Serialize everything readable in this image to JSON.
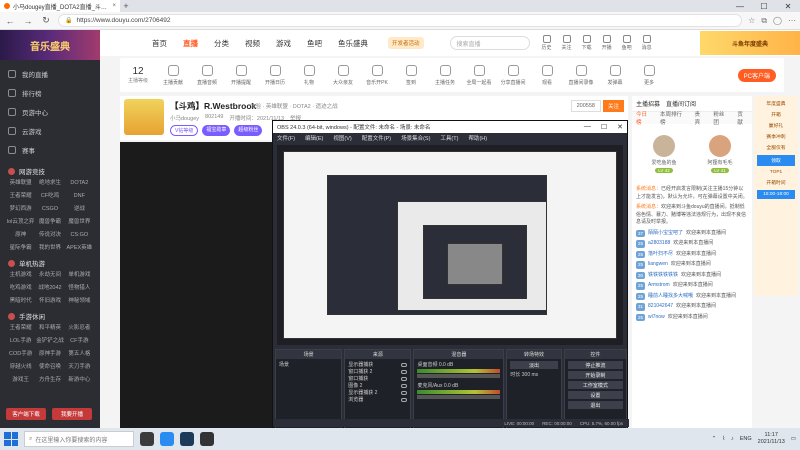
{
  "browser": {
    "tab_title": "小马dougey直播_DOTA2直播_斗…",
    "tab_close": "×",
    "new_tab": "+",
    "url": "https://www.douyu.com/2706492",
    "window_controls": [
      "—",
      "☐",
      "✕"
    ]
  },
  "sidebar": {
    "logo": "音乐盛典",
    "items": [
      {
        "label": "我的直播",
        "icon": "home-icon"
      },
      {
        "label": "排行榜",
        "icon": "rank-icon"
      },
      {
        "label": "页游中心",
        "icon": "game-center-icon"
      },
      {
        "label": "云游戏",
        "icon": "cloud-game-icon"
      },
      {
        "label": "赛事",
        "icon": "trophy-icon"
      }
    ],
    "sections": [
      {
        "title": "网游竞技",
        "games": [
          "英雄联盟",
          "绝地求生",
          "DOTA2",
          "王者荣耀",
          "CF吃鸡",
          "DNF",
          "梦幻西游",
          "CSGO",
          "逆战",
          "lol云顶之弈",
          "魔兽争霸",
          "魔兽世界",
          "原神",
          "传说对决",
          "CS:GO",
          "星际争霸",
          "我的世界",
          "APEX英雄"
        ]
      },
      {
        "title": "单机热游",
        "games": [
          "主机游戏",
          "永劫无间",
          "单机游戏",
          "吃鸡游戏",
          "战地2042",
          "怪物猎人",
          "黑暗时代",
          "怀旧游戏",
          "神秘领域"
        ]
      },
      {
        "title": "手游休闲",
        "games": [
          "王者荣耀",
          "和平精英",
          "火影忍者",
          "LOL手游",
          "金铲铲之战",
          "CF手游",
          "COD手游",
          "原神手游",
          "第五人格",
          "穿越火线",
          "使命召唤",
          "天刀手游",
          "游戏王",
          "方舟生存",
          "新游中心"
        ]
      }
    ],
    "bottom_buttons": [
      "客户端下载",
      "我要开播"
    ]
  },
  "topnav": {
    "items": [
      "首页",
      "直播",
      "分类",
      "视频",
      "游戏",
      "鱼吧",
      "鱼乐盛典"
    ],
    "active_index": 1,
    "badge": "开发者活动",
    "search_placeholder": "搜索直播",
    "icons": [
      {
        "label": "历史",
        "icon": "history-icon"
      },
      {
        "label": "关注",
        "icon": "follow-icon"
      },
      {
        "label": "下载",
        "icon": "download-icon"
      },
      {
        "label": "开播",
        "icon": "live-icon"
      },
      {
        "label": "鱼吧",
        "icon": "fishbar-icon"
      },
      {
        "label": "消息",
        "icon": "message-icon"
      }
    ],
    "promo": "斗鱼年度盛典"
  },
  "toolrow": {
    "rank_num": "12",
    "rank_label": "主播等级",
    "tools": [
      "主播贡献",
      "直播音频",
      "开播提醒",
      "开播日历",
      "礼物",
      "大众亲友",
      "音乐开PK",
      "签到",
      "主播任务",
      "全局一起看",
      "分享直播间",
      "观看",
      "直播间录像",
      "发弹幕",
      "更多"
    ],
    "pc_button": "PC客户端"
  },
  "anchor": {
    "title": "【斗鸡】R.Westbrook",
    "category": "体验 · 英雄联盟 · DOTA2 · 遗迹之战",
    "owner": "小马dougey",
    "followers": "802149",
    "meta1": "开播时间：2021/11/13",
    "meta2": "举报",
    "tags": [
      "V钻等级",
      "福宝勋章",
      "超级粉丝"
    ],
    "follow_count": "200558",
    "follow_btn": "关注"
  },
  "obs": {
    "title": "OBS 24.0.3 (64-bit, windows) - 配置文件: 未命名 - 场景: 未命名",
    "menu": [
      "文件(F)",
      "编辑(E)",
      "视图(V)",
      "配置文件(P)",
      "场景集合(S)",
      "工具(T)",
      "帮助(H)"
    ],
    "panels": {
      "scenes": {
        "title": "场景",
        "items": [
          "场景"
        ]
      },
      "sources": {
        "title": "来源",
        "items": [
          "显示器捕获",
          "窗口捕获 2",
          "窗口捕获",
          "图像 2",
          "显示器捕获 2",
          "浏览器"
        ]
      },
      "mixer": {
        "title": "混音器",
        "items": [
          "桌面音频",
          "麦克风/Aux"
        ],
        "levels": [
          "0.0 dB",
          "0.0 dB"
        ]
      },
      "transitions": {
        "title": "转场特效",
        "mode": "淡出",
        "duration_label": "时长",
        "duration": "300 ms"
      },
      "controls": {
        "title": "控件",
        "buttons": [
          "停止推流",
          "开始录制",
          "工作室模式",
          "设置",
          "退出"
        ]
      }
    },
    "status": [
      "LIVE: 00:00:00",
      "REC: 00:00:00",
      "CPU: 5.7%, 60.00 fps"
    ]
  },
  "rightpanel": {
    "top": [
      "主播招募",
      "直播间订阅"
    ],
    "tabs": [
      "今日榜",
      "本周排行榜",
      "贵宾",
      "粉丝团",
      "贡献"
    ],
    "cards": [
      {
        "name": "爱吃鱼的鱼",
        "level": "LV 42"
      },
      {
        "name": "阿狸有毛毛",
        "level": "LV 41"
      }
    ],
    "sys_title": "系统消息：",
    "sys_msg_1": "已经开启发言限制(关注主播15分钟以上才能发言)，默认为允许，可在弹幕设置中关闭。",
    "sys_msg_2": "欢迎来到斗鱼douyu的直播间。抵制低俗色情、暴力、赌博等违法违规行为，出现不良信息请及时举报。",
    "chat": [
      {
        "level": "37",
        "name": "陌陌小宝宝吧了",
        "text": "欢迎来到本直播间"
      },
      {
        "level": "25",
        "name": "a2803188",
        "text": "欢迎来到本直播间"
      },
      {
        "level": "25",
        "name": "落叶扫不尽",
        "text": "欢迎来到本直播间"
      },
      {
        "level": "25",
        "name": "liangwen",
        "text": "欢迎来到本直播间"
      },
      {
        "level": "30",
        "name": "铁铁铁铁铁铁",
        "text": "欢迎来到本直播间"
      },
      {
        "level": "25",
        "name": "Armstrom",
        "text": "欢迎来到本直播间"
      },
      {
        "level": "25",
        "name": "睡前人睡找多大喊哦",
        "text": "欢迎来到本直播间"
      },
      {
        "level": "31",
        "name": "821042647",
        "text": "欢迎来到本直播间"
      },
      {
        "level": "25",
        "name": "wl7now",
        "text": "欢迎来到本直播间"
      }
    ]
  },
  "rightad": [
    "年度盛典",
    "开箱",
    "赢好礼",
    "赛季冲刺",
    "全服仅有",
    "领取",
    "TOP1",
    "开箱时间",
    "15:00-18:00"
  ],
  "taskbar": {
    "search": "在这里输入你要搜索的内容",
    "lang": "ENG",
    "time": "11:17",
    "date": "2021/11/13"
  }
}
